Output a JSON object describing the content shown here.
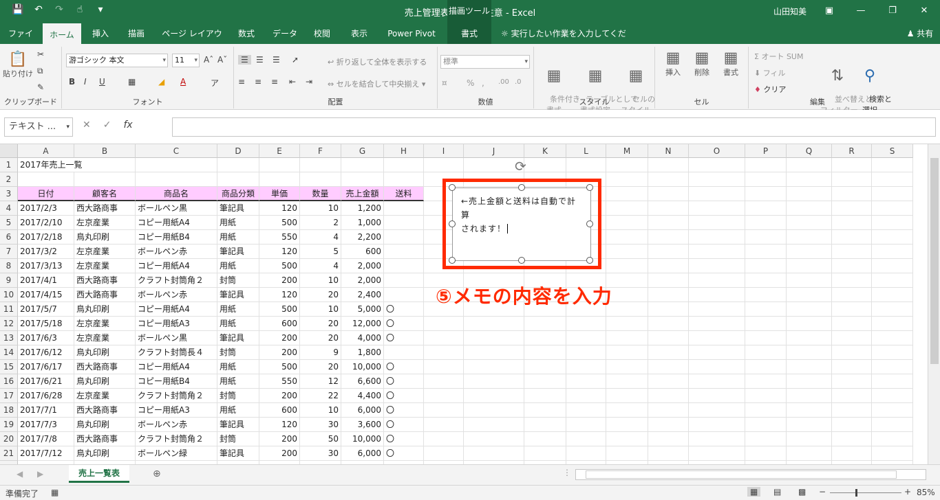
{
  "title": {
    "doc": "売上管理表入力上の注意",
    "app": "Excel",
    "separator": "-"
  },
  "draw_tools": "描画ツール",
  "user": "山田知美",
  "share": "共有",
  "qat": [
    "save-icon",
    "undo-icon",
    "redo-icon",
    "touch-mode-icon",
    "customize-icon"
  ],
  "tabs": [
    "ファイル",
    "ホーム",
    "挿入",
    "描画",
    "ページ レイアウト",
    "数式",
    "データ",
    "校閲",
    "表示",
    "Power Pivot",
    "書式"
  ],
  "tell_me": "実行したい作業を入力してください",
  "ribbon": {
    "clipboard": {
      "label": "クリップボード",
      "paste": "貼り付け"
    },
    "font": {
      "label": "フォント",
      "name": "游ゴシック 本文",
      "size": "11"
    },
    "alignment": {
      "label": "配置",
      "wrap": "折り返して全体を表示する",
      "merge": "セルを結合して中央揃え"
    },
    "number": {
      "label": "数値",
      "format": "標準"
    },
    "styles": {
      "label": "スタイル",
      "cond": "条件付き\n書式",
      "table": "テーブルとして\n書式設定",
      "cell": "セルの\nスタイル"
    },
    "cells": {
      "label": "セル",
      "insert": "挿入",
      "delete": "削除",
      "format": "書式"
    },
    "editing": {
      "label": "編集",
      "autosum": "オート SUM",
      "fill": "フィル",
      "clear": "クリア",
      "sort": "並べ替えと\nフィルター",
      "find": "検索と\n選択"
    }
  },
  "namebox": "テキスト ...",
  "columns": [
    "A",
    "B",
    "C",
    "D",
    "E",
    "F",
    "G",
    "H",
    "I",
    "J",
    "K",
    "L",
    "M",
    "N",
    "O",
    "P",
    "Q",
    "R",
    "S"
  ],
  "sheet_title": "2017年売上一覧",
  "table_headers": [
    "日付",
    "顧客名",
    "商品名",
    "商品分類",
    "単価",
    "数量",
    "売上金額",
    "送料"
  ],
  "rows": [
    [
      "2017/2/3",
      "西大路商事",
      "ボールペン黒",
      "筆記具",
      "120",
      "10",
      "1,200",
      ""
    ],
    [
      "2017/2/10",
      "左京産業",
      "コピー用紙A4",
      "用紙",
      "500",
      "2",
      "1,000",
      ""
    ],
    [
      "2017/2/18",
      "鳥丸印刷",
      "コピー用紙B4",
      "用紙",
      "550",
      "4",
      "2,200",
      ""
    ],
    [
      "2017/3/2",
      "左京産業",
      "ボールペン赤",
      "筆記具",
      "120",
      "5",
      "600",
      ""
    ],
    [
      "2017/3/13",
      "左京産業",
      "コピー用紙A4",
      "用紙",
      "500",
      "4",
      "2,000",
      ""
    ],
    [
      "2017/4/1",
      "西大路商事",
      "クラフト封筒角２",
      "封筒",
      "200",
      "10",
      "2,000",
      ""
    ],
    [
      "2017/4/15",
      "西大路商事",
      "ボールペン赤",
      "筆記具",
      "120",
      "20",
      "2,400",
      ""
    ],
    [
      "2017/5/7",
      "鳥丸印刷",
      "コピー用紙A4",
      "用紙",
      "500",
      "10",
      "5,000",
      "〇"
    ],
    [
      "2017/5/18",
      "左京産業",
      "コピー用紙A3",
      "用紙",
      "600",
      "20",
      "12,000",
      "〇"
    ],
    [
      "2017/6/3",
      "左京産業",
      "ボールペン黒",
      "筆記具",
      "200",
      "20",
      "4,000",
      "〇"
    ],
    [
      "2017/6/12",
      "鳥丸印刷",
      "クラフト封筒長４",
      "封筒",
      "200",
      "9",
      "1,800",
      ""
    ],
    [
      "2017/6/17",
      "西大路商事",
      "コピー用紙A4",
      "用紙",
      "500",
      "20",
      "10,000",
      "〇"
    ],
    [
      "2017/6/21",
      "鳥丸印刷",
      "コピー用紙B4",
      "用紙",
      "550",
      "12",
      "6,600",
      "〇"
    ],
    [
      "2017/6/28",
      "左京産業",
      "クラフト封筒角２",
      "封筒",
      "200",
      "22",
      "4,400",
      "〇"
    ],
    [
      "2017/7/1",
      "西大路商事",
      "コピー用紙A3",
      "用紙",
      "600",
      "10",
      "6,000",
      "〇"
    ],
    [
      "2017/7/3",
      "鳥丸印刷",
      "ボールペン赤",
      "筆記具",
      "120",
      "30",
      "3,600",
      "〇"
    ],
    [
      "2017/7/8",
      "西大路商事",
      "クラフト封筒角２",
      "封筒",
      "200",
      "50",
      "10,000",
      "〇"
    ],
    [
      "2017/7/12",
      "鳥丸印刷",
      "ボールペン緑",
      "筆記具",
      "200",
      "30",
      "6,000",
      "〇"
    ]
  ],
  "textbox": {
    "line1": "←売上金額と送料は自動で計算",
    "line2": "されます！"
  },
  "annotation": "⑤メモの内容を入力",
  "sheet_tab": "売上一覧表",
  "status": "準備完了",
  "zoom": "85%",
  "colors": {
    "excel_green": "#217346",
    "header_pink": "#ffccff",
    "annotation_red": "#ff2a00"
  }
}
